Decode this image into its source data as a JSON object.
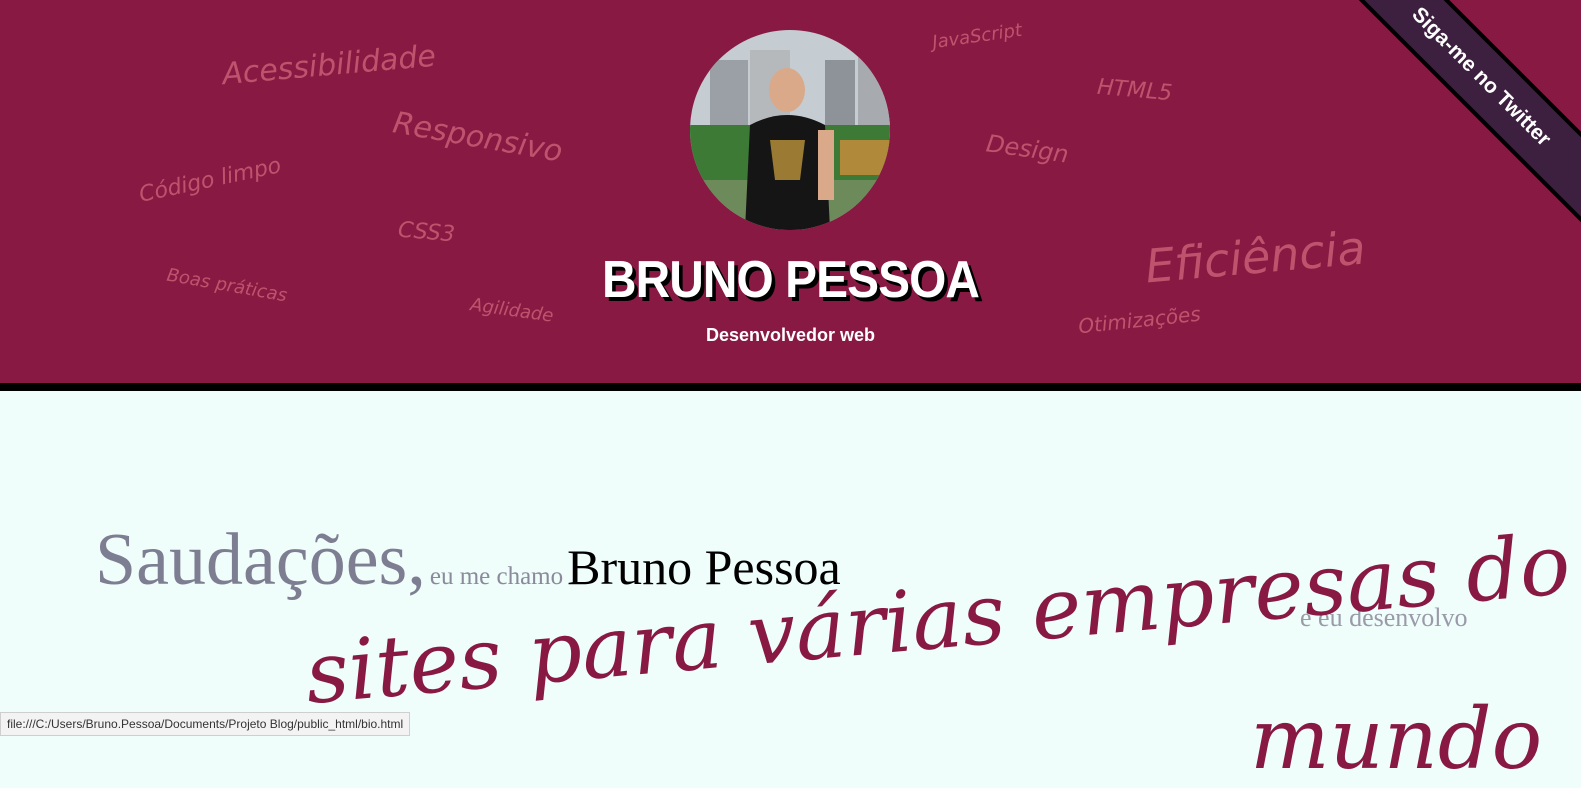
{
  "header": {
    "name": "BRUNO PESSOA",
    "subtitle": "Desenvolvedor web",
    "ribbon": "Siga-me no Twitter",
    "tags": [
      "Acessibilidade",
      "Responsivo",
      "Código limpo",
      "CSS3",
      "Boas práticas",
      "Agilidade",
      "JavaScript",
      "HTML5",
      "Design",
      "Eficiência",
      "Otimizações"
    ]
  },
  "content": {
    "greet": "Saudações,",
    "me_call": "eu me chamo",
    "name": "Bruno Pessoa",
    "develop": "e eu desenvolvo",
    "big_line": "sites para várias empresas do",
    "big_line2": "mundo"
  },
  "status": {
    "url": "file:///C:/Users/Bruno.Pessoa/Documents/Projeto Blog/public_html/bio.html"
  }
}
